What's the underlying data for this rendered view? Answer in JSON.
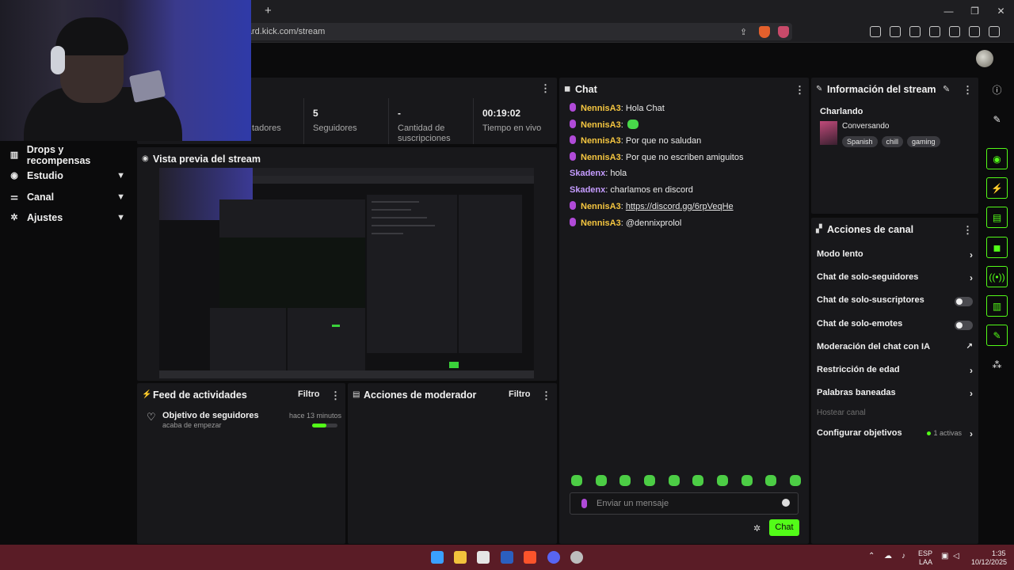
{
  "browser": {
    "url": "shboard.kick.com/stream",
    "new_tab": "+",
    "controls": [
      "—",
      "❐",
      "✕"
    ]
  },
  "sidebar": {
    "items": [
      {
        "label": "Drops y recompensas",
        "icon": "gift-icon"
      },
      {
        "label": "Estudio",
        "icon": "studio-icon"
      },
      {
        "label": "Canal",
        "icon": "channel-icon"
      },
      {
        "label": "Ajustes",
        "icon": "gear-icon"
      }
    ]
  },
  "stats": {
    "items": [
      {
        "value": "",
        "label": "tadores"
      },
      {
        "value": "5",
        "label": "Seguidores"
      },
      {
        "value": "-",
        "label": "Cantidad de suscripciones"
      },
      {
        "value": "00:19:02",
        "label": "Tiempo en vivo"
      }
    ]
  },
  "preview": {
    "title": "Vista previa del stream"
  },
  "activity": {
    "title": "Feed de actividades",
    "filter": "Filtro",
    "item_title": "Objetivo de seguidores",
    "item_sub": "acaba de empezar",
    "item_time": "hace 13 minutos",
    "progress": 0.55
  },
  "mod_actions": {
    "title": "Acciones de moderador",
    "filter": "Filtro"
  },
  "chat": {
    "title": "Chat",
    "messages": [
      {
        "user": "NennisA3",
        "text": ": Hola Chat",
        "badge": true
      },
      {
        "user": "NennisA3",
        "text": ":",
        "badge": true,
        "emote": true
      },
      {
        "user": "NennisA3",
        "text": ": Por que no saludan",
        "badge": true
      },
      {
        "user": "NennisA3",
        "text": ": Por que no escriben amiguitos",
        "badge": true
      },
      {
        "user": "Skadenx",
        "text": ": hola",
        "badge": false
      },
      {
        "user": "Skadenx",
        "text": ": charlamos en discord",
        "badge": false
      },
      {
        "user": "NennisA3",
        "text": ": ",
        "link": "https://discord.gg/6rpVeqHe",
        "badge": true
      },
      {
        "user": "NennisA3",
        "text": ": @dennixprolol",
        "badge": true
      }
    ],
    "placeholder": "Enviar un mensaje",
    "send_label": "Chat"
  },
  "stream_info": {
    "title": "Información del stream",
    "stream_title": "Charlando",
    "category": "Conversando",
    "tags": [
      "Spanish",
      "chill",
      "gaming"
    ]
  },
  "channel_actions": {
    "title": "Acciones de canal",
    "rows": [
      {
        "label": "Modo lento",
        "kind": "arrow"
      },
      {
        "label": "Chat de solo-seguidores",
        "kind": "arrow"
      },
      {
        "label": "Chat de solo-suscriptores",
        "kind": "toggle"
      },
      {
        "label": "Chat de solo-emotes",
        "kind": "toggle"
      },
      {
        "label": "Moderación del chat con IA",
        "kind": "external"
      },
      {
        "label": "Restricción de edad",
        "kind": "arrow"
      },
      {
        "label": "Palabras baneadas",
        "kind": "arrow"
      },
      {
        "label": "Hostear canal",
        "kind": "disabled"
      },
      {
        "label": "Configurar objetivos",
        "kind": "arrow",
        "badge": "1 activas"
      }
    ]
  },
  "taskbar": {
    "lang": "ESP",
    "layout": "LAA",
    "time": "1:35",
    "date": "10/12/2025"
  },
  "colors": {
    "accent": "#53fc18",
    "nick_yellow": "#f5c640",
    "nick_purple": "#c59cff",
    "taskbar": "#5a1c26"
  }
}
